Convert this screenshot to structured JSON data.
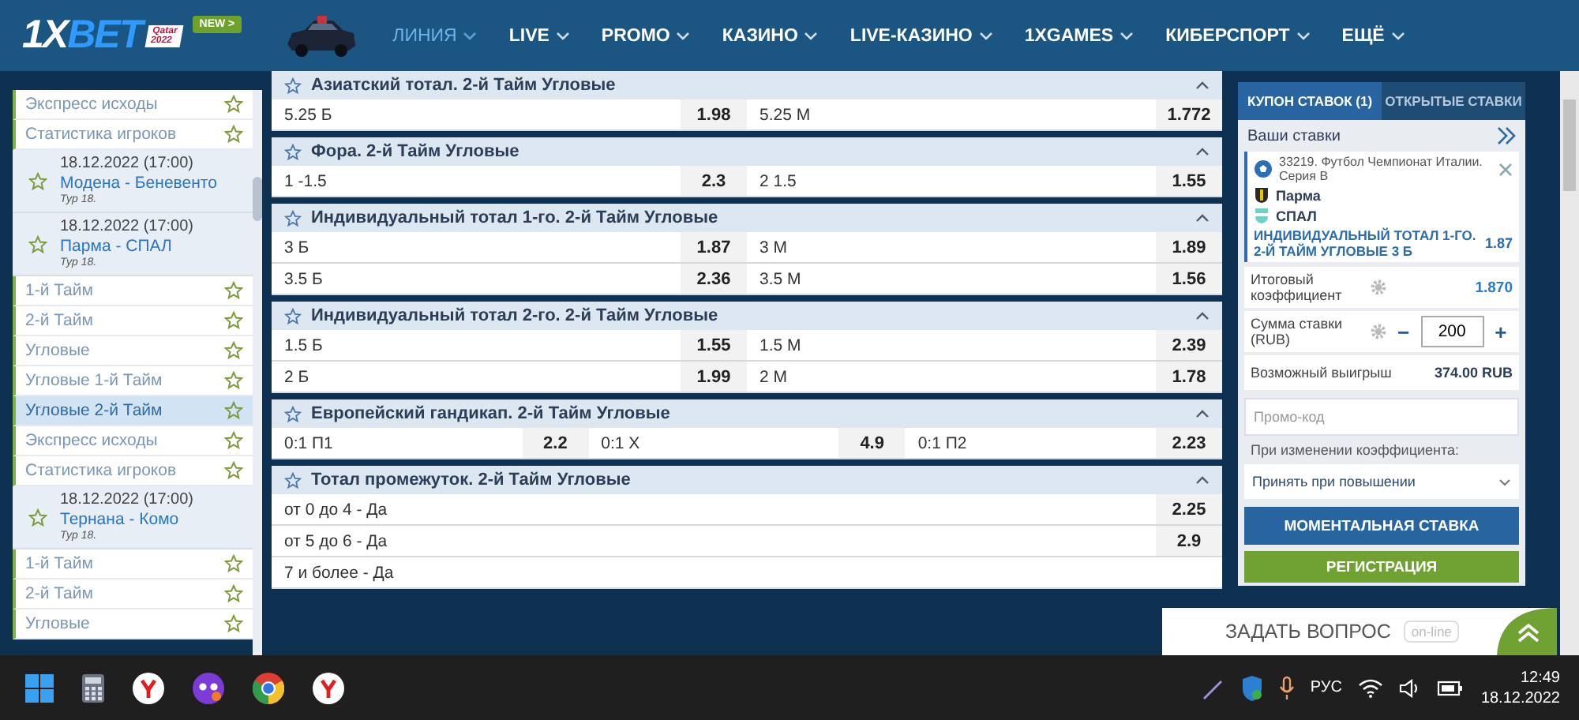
{
  "header": {
    "logo": {
      "part1": "1X",
      "part2": "BET"
    },
    "logo_badge": [
      "Qatar",
      "2022"
    ],
    "new_badge": "NEW >",
    "nav": [
      {
        "label": "ЛИНИЯ",
        "selected": true
      },
      {
        "label": "LIVE",
        "selected": false
      },
      {
        "label": "PROMO",
        "selected": false
      },
      {
        "label": "КАЗИНО",
        "selected": false
      },
      {
        "label": "LIVE-КАЗИНО",
        "selected": false
      },
      {
        "label": "1XGAMES",
        "selected": false
      },
      {
        "label": "КИБЕРСПОРТ",
        "selected": false
      },
      {
        "label": "ЕЩЁ",
        "selected": false
      }
    ]
  },
  "sidebar": {
    "items": [
      {
        "kind": "market",
        "label": "Экспресс исходы",
        "selected": false
      },
      {
        "kind": "market",
        "label": "Статистика игроков",
        "selected": false
      },
      {
        "kind": "match",
        "date": "18.12.2022 (17:00)",
        "teams": "Модена - Беневенто",
        "round": "Тур 18."
      },
      {
        "kind": "match",
        "date": "18.12.2022 (17:00)",
        "teams": "Парма - СПАЛ",
        "round": "Тур 18."
      },
      {
        "kind": "market",
        "label": "1-й Тайм",
        "selected": false
      },
      {
        "kind": "market",
        "label": "2-й Тайм",
        "selected": false
      },
      {
        "kind": "market",
        "label": "Угловые",
        "selected": false
      },
      {
        "kind": "market",
        "label": "Угловые 1-й Тайм",
        "selected": false
      },
      {
        "kind": "market",
        "label": "Угловые 2-й Тайм",
        "selected": true
      },
      {
        "kind": "market",
        "label": "Экспресс исходы",
        "selected": false
      },
      {
        "kind": "market",
        "label": "Статистика игроков",
        "selected": false
      },
      {
        "kind": "match",
        "date": "18.12.2022 (17:00)",
        "teams": "Тернана - Комо",
        "round": "Тур 18."
      },
      {
        "kind": "market",
        "label": "1-й Тайм",
        "selected": false
      },
      {
        "kind": "market",
        "label": "2-й Тайм",
        "selected": false
      },
      {
        "kind": "market",
        "label": "Угловые",
        "selected": false
      }
    ]
  },
  "markets": [
    {
      "title": "Азиатский тотал. 2-й Тайм Угловые",
      "rows": [
        {
          "outcomes": [
            {
              "label": "5.25 Б",
              "odds": "1.98"
            },
            {
              "label": "5.25 М",
              "odds": "1.772"
            }
          ]
        }
      ]
    },
    {
      "title": "Фора. 2-й Тайм Угловые",
      "rows": [
        {
          "outcomes": [
            {
              "label": "1 -1.5",
              "odds": "2.3"
            },
            {
              "label": "2 1.5",
              "odds": "1.55"
            }
          ]
        }
      ]
    },
    {
      "title": "Индивидуальный тотал 1-го. 2-й Тайм Угловые",
      "rows": [
        {
          "outcomes": [
            {
              "label": "3 Б",
              "odds": "1.87"
            },
            {
              "label": "3 М",
              "odds": "1.89"
            }
          ]
        },
        {
          "outcomes": [
            {
              "label": "3.5 Б",
              "odds": "2.36"
            },
            {
              "label": "3.5 М",
              "odds": "1.56"
            }
          ]
        }
      ]
    },
    {
      "title": "Индивидуальный тотал 2-го. 2-й Тайм Угловые",
      "rows": [
        {
          "outcomes": [
            {
              "label": "1.5 Б",
              "odds": "1.55"
            },
            {
              "label": "1.5 М",
              "odds": "2.39"
            }
          ]
        },
        {
          "outcomes": [
            {
              "label": "2 Б",
              "odds": "1.99"
            },
            {
              "label": "2 М",
              "odds": "1.78"
            }
          ]
        }
      ]
    },
    {
      "title": "Европейский гандикап. 2-й Тайм Угловые",
      "rows": [
        {
          "outcomes": [
            {
              "label": "0:1 П1",
              "odds": "2.2"
            },
            {
              "label": "0:1 Х",
              "odds": "4.9"
            },
            {
              "label": "0:1 П2",
              "odds": "2.23"
            }
          ]
        }
      ]
    },
    {
      "title": "Тотал промежуток. 2-й Тайм Угловые",
      "rows": [
        {
          "outcomes": [
            {
              "label": "от 0 до 4 - Да",
              "odds": "2.25"
            }
          ]
        },
        {
          "outcomes": [
            {
              "label": "от 5 до 6 - Да",
              "odds": "2.9"
            }
          ]
        },
        {
          "outcomes": [
            {
              "label": "7 и более - Да"
            }
          ]
        }
      ]
    }
  ],
  "coupon": {
    "tabs": [
      {
        "label": "КУПОН СТАВОК (1)",
        "selected": true
      },
      {
        "label": "ОТКРЫТЫЕ СТАВКИ",
        "selected": false
      }
    ],
    "heading": "Ваши ставки",
    "bet": {
      "event": "33219. Футбол Чемпионат Италии. Серия B",
      "team1": "Парма",
      "team2": "СПАЛ",
      "pick": "ИНДИВИДУАЛЬНЫЙ ТОТАЛ 1-ГО. 2-Й ТАЙМ УГЛОВЫЕ 3 Б",
      "odds": "1.87"
    },
    "total_label": "Итоговый коэффициент",
    "total_value": "1.870",
    "stake_label": "Сумма ставки (RUB)",
    "stake_minus": "−",
    "stake_value": "200",
    "stake_plus": "+",
    "win_label": "Возможный выигрыш",
    "win_value": "374.00 RUB",
    "promo_placeholder": "Промо-код",
    "change_label": "При изменении коэффициента:",
    "change_value": "Принять при повышении",
    "instant_button": "МОМЕНТАЛЬНАЯ СТАВКА",
    "register_button": "РЕГИСТРАЦИЯ"
  },
  "chat": {
    "label": "ЗАДАТЬ ВОПРОС",
    "status": "on-line"
  },
  "taskbar": {
    "language": "РУС",
    "time": "12:49",
    "date": "18.12.2022"
  }
}
